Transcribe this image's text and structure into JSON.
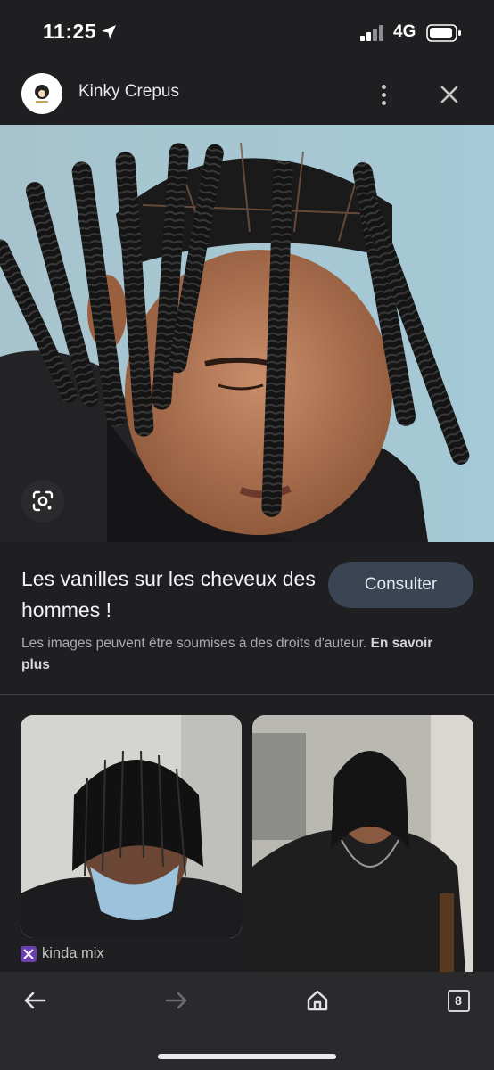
{
  "status_bar": {
    "time": "11:25",
    "network": "4G"
  },
  "header": {
    "site_name": "Kinky Crepus",
    "more_icon": "more-vert-icon",
    "close_icon": "close-icon"
  },
  "hero": {
    "lens_icon": "google-lens-icon"
  },
  "info": {
    "title": "Les vanilles sur les cheveux des hommes !",
    "visit_label": "Consulter",
    "copyright_text": "Les images peuvent être soumises à des droits d'auteur.",
    "learn_more": "En savoir plus"
  },
  "related": {
    "items": [
      {
        "source": "kinda mix"
      }
    ]
  },
  "bottom_bar": {
    "tab_count": "8"
  },
  "colors": {
    "background": "#1f1f22",
    "button": "#3a4452",
    "bar": "#2a2a2d"
  }
}
